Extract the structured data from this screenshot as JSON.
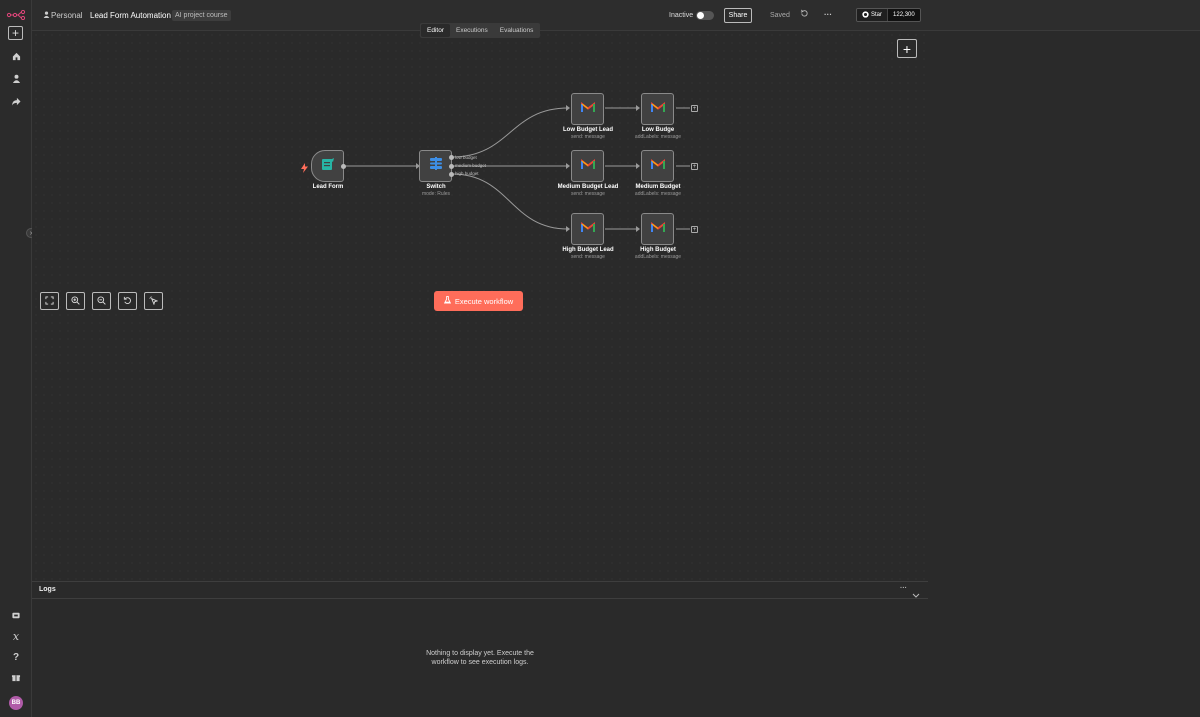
{
  "header": {
    "owner": "Personal",
    "workflow_name": "Lead Form Automation",
    "tag": "AI project course",
    "status": "Inactive",
    "share_label": "Share",
    "saved_label": "Saved",
    "more_label": "···",
    "star_label": "Star",
    "star_count": "122,300"
  },
  "tabs": [
    {
      "label": "Editor",
      "active": true
    },
    {
      "label": "Executions",
      "active": false
    },
    {
      "label": "Evaluations",
      "active": false
    }
  ],
  "nodes": {
    "lead_form": {
      "label": "Lead Form",
      "sub": ""
    },
    "switch": {
      "label": "Switch",
      "sub": "mode: Rules"
    },
    "low_lead": {
      "label": "Low Budget Lead",
      "sub": "send: message"
    },
    "low_budge": {
      "label": "Low Budge",
      "sub": "addLabels: message"
    },
    "medium_lead": {
      "label": "Medium Budget Lead",
      "sub": "send: message"
    },
    "medium_budget": {
      "label": "Medium Budget",
      "sub": "addLabels: message"
    },
    "high_lead": {
      "label": "High Budget Lead",
      "sub": "send: message"
    },
    "high_budget": {
      "label": "High Budget",
      "sub": "addLabels: message"
    }
  },
  "switch_outputs": [
    "low budget",
    "medium budget",
    "high budget"
  ],
  "canvas": {
    "execute_label": "Execute workflow"
  },
  "logs": {
    "title": "Logs",
    "empty_message": "Nothing to display yet. Execute the workflow to see execution logs."
  },
  "sidebar": {
    "avatar_initials": "BB"
  },
  "colors": {
    "accent": "#ff6d5a",
    "background": "#2a2a2a",
    "logo": "#e0457a"
  }
}
